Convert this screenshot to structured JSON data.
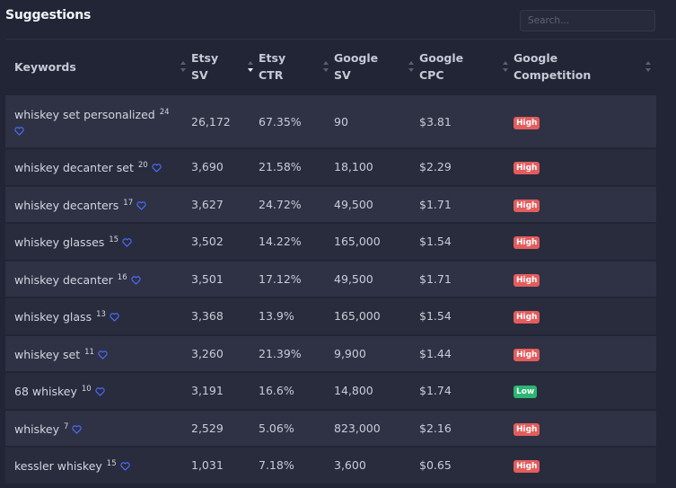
{
  "title": "Suggestions",
  "search": {
    "placeholder": "Search..."
  },
  "headers": [
    {
      "line1": "Keywords",
      "line2": ""
    },
    {
      "line1": "Etsy",
      "line2": "SV"
    },
    {
      "line1": "Etsy",
      "line2": "CTR"
    },
    {
      "line1": "Google",
      "line2": "SV"
    },
    {
      "line1": "Google",
      "line2": "CPC"
    },
    {
      "line1": "Google",
      "line2": "Competition"
    }
  ],
  "colors": {
    "high": "#e35d5d",
    "low": "#2bb673",
    "heart": "#4d6bff"
  },
  "rows": [
    {
      "keyword": "whiskey set personalized",
      "count": "24",
      "etsy_sv": "26,172",
      "etsy_ctr": "67.35%",
      "google_sv": "90",
      "google_cpc": "$3.81",
      "competition": "High"
    },
    {
      "keyword": "whiskey decanter set",
      "count": "20",
      "etsy_sv": "3,690",
      "etsy_ctr": "21.58%",
      "google_sv": "18,100",
      "google_cpc": "$2.29",
      "competition": "High"
    },
    {
      "keyword": "whiskey decanters",
      "count": "17",
      "etsy_sv": "3,627",
      "etsy_ctr": "24.72%",
      "google_sv": "49,500",
      "google_cpc": "$1.71",
      "competition": "High"
    },
    {
      "keyword": "whiskey glasses",
      "count": "15",
      "etsy_sv": "3,502",
      "etsy_ctr": "14.22%",
      "google_sv": "165,000",
      "google_cpc": "$1.54",
      "competition": "High"
    },
    {
      "keyword": "whiskey decanter",
      "count": "16",
      "etsy_sv": "3,501",
      "etsy_ctr": "17.12%",
      "google_sv": "49,500",
      "google_cpc": "$1.71",
      "competition": "High"
    },
    {
      "keyword": "whiskey glass",
      "count": "13",
      "etsy_sv": "3,368",
      "etsy_ctr": "13.9%",
      "google_sv": "165,000",
      "google_cpc": "$1.54",
      "competition": "High"
    },
    {
      "keyword": "whiskey set",
      "count": "11",
      "etsy_sv": "3,260",
      "etsy_ctr": "21.39%",
      "google_sv": "9,900",
      "google_cpc": "$1.44",
      "competition": "High"
    },
    {
      "keyword": "68 whiskey",
      "count": "10",
      "etsy_sv": "3,191",
      "etsy_ctr": "16.6%",
      "google_sv": "14,800",
      "google_cpc": "$1.74",
      "competition": "Low"
    },
    {
      "keyword": "whiskey",
      "count": "7",
      "etsy_sv": "2,529",
      "etsy_ctr": "5.06%",
      "google_sv": "823,000",
      "google_cpc": "$2.16",
      "competition": "High"
    },
    {
      "keyword": "kessler whiskey",
      "count": "15",
      "etsy_sv": "1,031",
      "etsy_ctr": "7.18%",
      "google_sv": "3,600",
      "google_cpc": "$0.65",
      "competition": "High"
    }
  ]
}
